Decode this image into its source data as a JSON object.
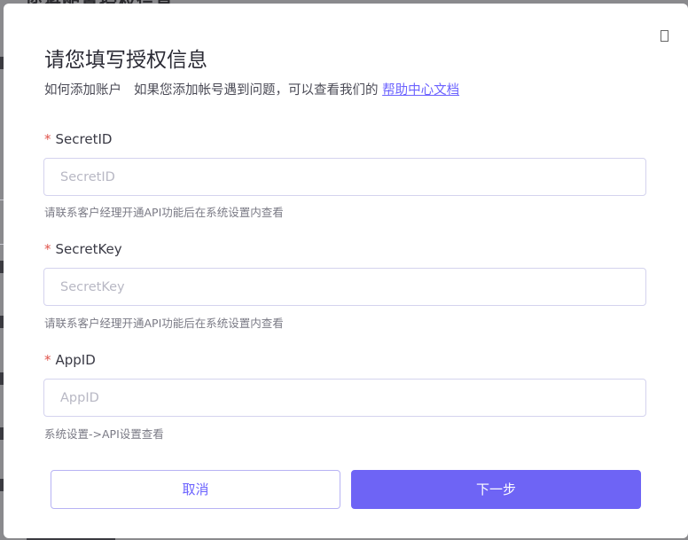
{
  "background": {
    "title": "您将配置授权信息"
  },
  "modal": {
    "title": "请您填写授权信息",
    "close_icon": "close-icon",
    "help": {
      "prefix": "如何添加账户",
      "text": "如果您添加帐号遇到问题，可以查看我们的",
      "link": "帮助中心文档"
    },
    "fields": [
      {
        "required_mark": "*",
        "label": "SecretID",
        "placeholder": "SecretID",
        "value": "",
        "hint": "请联系客户经理开通API功能后在系统设置内查看"
      },
      {
        "required_mark": "*",
        "label": "SecretKey",
        "placeholder": "SecretKey",
        "value": "",
        "hint": "请联系客户经理开通API功能后在系统设置内查看"
      },
      {
        "required_mark": "*",
        "label": "AppID",
        "placeholder": "AppID",
        "value": "",
        "hint": "系统设置->API设置查看"
      }
    ],
    "buttons": {
      "cancel": "取消",
      "next": "下一步"
    }
  },
  "colors": {
    "accent": "#6e64f5",
    "link": "#6c63ff",
    "required": "#e0544c"
  }
}
